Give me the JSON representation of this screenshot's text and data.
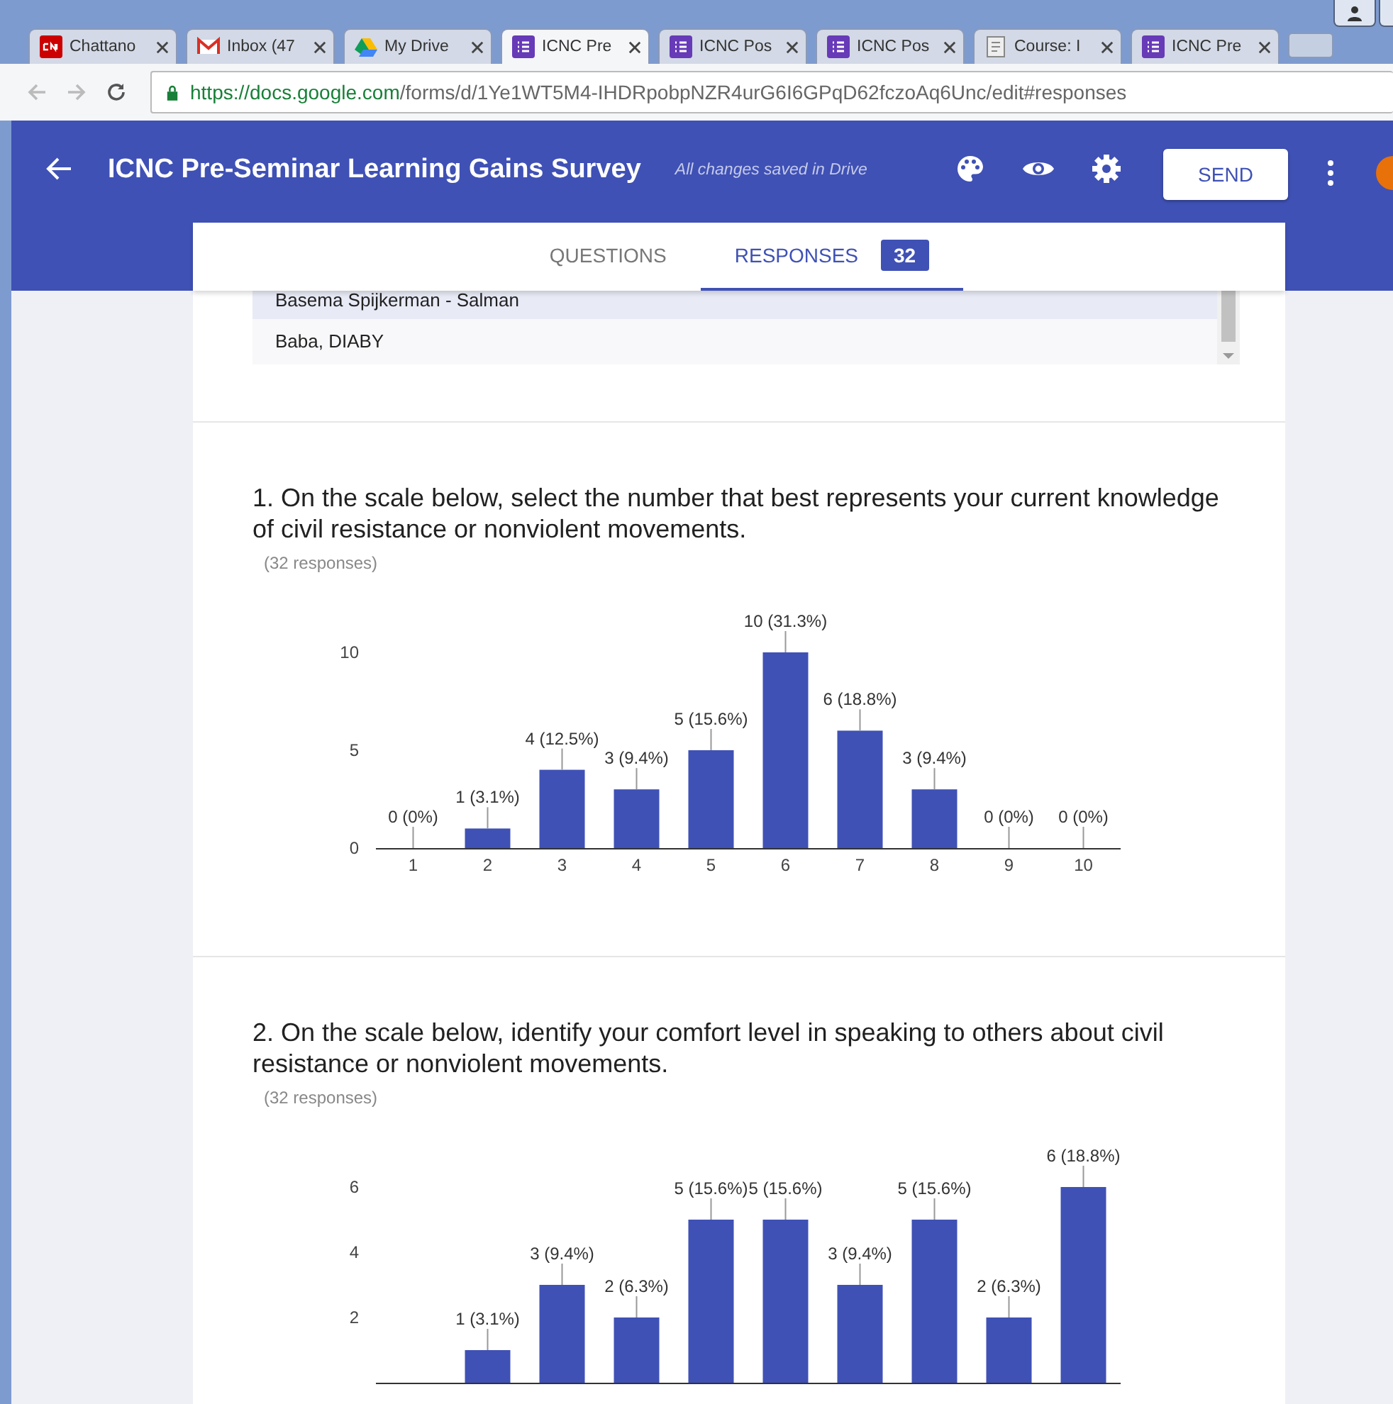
{
  "browser": {
    "tabs": [
      {
        "label": "Chattano",
        "kind": "news",
        "selected": false
      },
      {
        "label": "Inbox (47",
        "kind": "mail",
        "selected": false
      },
      {
        "label": "My Drive",
        "kind": "drive",
        "selected": false
      },
      {
        "label": "ICNC Pre",
        "kind": "form",
        "selected": true
      },
      {
        "label": "ICNC Pos",
        "kind": "form",
        "selected": false
      },
      {
        "label": "ICNC Pos",
        "kind": "form",
        "selected": false
      },
      {
        "label": "Course: I",
        "kind": "doc",
        "selected": false
      },
      {
        "label": "ICNC Pre",
        "kind": "form",
        "selected": false
      }
    ],
    "url": {
      "host": "https://docs.google.com",
      "path": "/forms/d/1Ye1WT5M4-IHDRpobpNZR4urG6I6GPqD62fczoAq6Unc/edit#responses"
    }
  },
  "header": {
    "title": "ICNC Pre-Seminar Learning Gains Survey",
    "save_status": "All changes saved in Drive",
    "send_button": "SEND"
  },
  "tabs": [
    {
      "label": "QUESTIONS",
      "selected": false
    },
    {
      "label": "RESPONSES",
      "selected": true,
      "count": "32"
    }
  ],
  "respondents": [
    {
      "name": "Basema Spijkerman - Salman",
      "selected": true
    },
    {
      "name": "Baba, DIABY",
      "selected": false
    }
  ],
  "questions": [
    {
      "title": "1. On the scale below, select the number that best represents your current knowledge of civil resistance or nonviolent movements.",
      "responses": "(32 responses)",
      "chart_data": {
        "type": "bar",
        "categories": [
          "1",
          "2",
          "3",
          "4",
          "5",
          "6",
          "7",
          "8",
          "9",
          "10"
        ],
        "values": [
          0,
          1,
          4,
          3,
          5,
          10,
          6,
          3,
          0,
          0
        ],
        "ylim": [
          0,
          10
        ],
        "yticks": [
          0,
          5,
          10
        ],
        "value_labels": [
          "0 (0%)",
          "1 (3.1%)",
          "4 (12.5%)",
          "3 (9.4%)",
          "5 (15.6%)",
          "10 (31.3%)",
          "6 (18.8%)",
          "3 (9.4%)",
          "0 (0%)",
          "0 (0%)"
        ]
      }
    },
    {
      "title": "2. On the scale below, identify your comfort level in speaking to others about civil resistance or nonviolent movements.",
      "responses": "(32 responses)",
      "chart_data": {
        "type": "bar",
        "values": [
          null,
          1,
          3,
          2,
          5,
          5,
          3,
          5,
          2,
          6
        ],
        "ylim": [
          0,
          6
        ],
        "yticks": [
          2,
          4,
          6
        ],
        "value_labels": [
          null,
          "1 (3.1%)",
          "3 (9.4%)",
          "2 (6.3%)",
          "5 (15.6%)",
          "5 (15.6%)",
          "3 (9.4%)",
          "5 (15.6%)",
          "2 (6.3%)",
          "6 (18.8%)"
        ]
      }
    }
  ]
}
